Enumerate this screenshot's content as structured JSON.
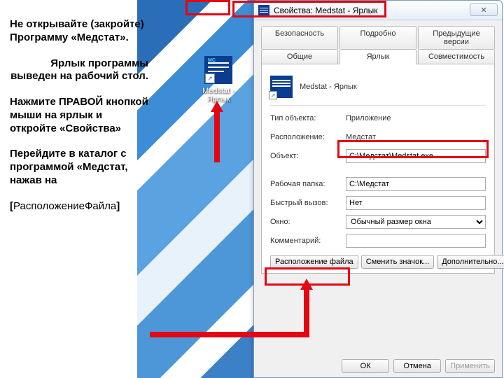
{
  "instructions": {
    "p1": "Не открывайте (закройте) Программу «Медстат».",
    "p2": "Ярлык программы выведен на рабочий стол.",
    "p3": "Нажмите ПРАВОЙ кнопкой мыши на ярлык и откройте «Свойства»",
    "p4": "Перейдите в каталог с программой «Медстат, нажав на",
    "p5_bracket_open": "[",
    "p5_text": "РасположениеФайла",
    "p5_bracket_close": "]"
  },
  "desktop_icon": {
    "label": "Medstat - Ярлык"
  },
  "dialog": {
    "title": "Свойства: Medstat - Ярлык",
    "close_glyph": "✕",
    "tabs_row1": [
      "Безопасность",
      "Подробно",
      "Предыдущие версии"
    ],
    "tabs_row2": [
      "Общие",
      "Ярлык",
      "Совместимость"
    ],
    "active_tab_index": 1,
    "header_name": "Medstat - Ярлык",
    "fields": {
      "type_label": "Тип объекта:",
      "type_value": "Приложение",
      "location_label": "Расположение:",
      "location_value": "Медстат",
      "target_label": "Объект:",
      "target_value": "C:\\Медстат\\Medstat.exe",
      "workdir_label": "Рабочая папка:",
      "workdir_value": "C:\\Медстат",
      "hotkey_label": "Быстрый вызов:",
      "hotkey_value": "Нет",
      "window_label": "Окно:",
      "window_value": "Обычный размер окна",
      "comment_label": "Комментарий:",
      "comment_value": ""
    },
    "buttons": {
      "open_location": "Расположение файла",
      "change_icon": "Сменить значок...",
      "advanced": "Дополнительно..."
    },
    "footer": {
      "ok": "ОК",
      "cancel": "Отмена",
      "apply": "Применить"
    }
  }
}
